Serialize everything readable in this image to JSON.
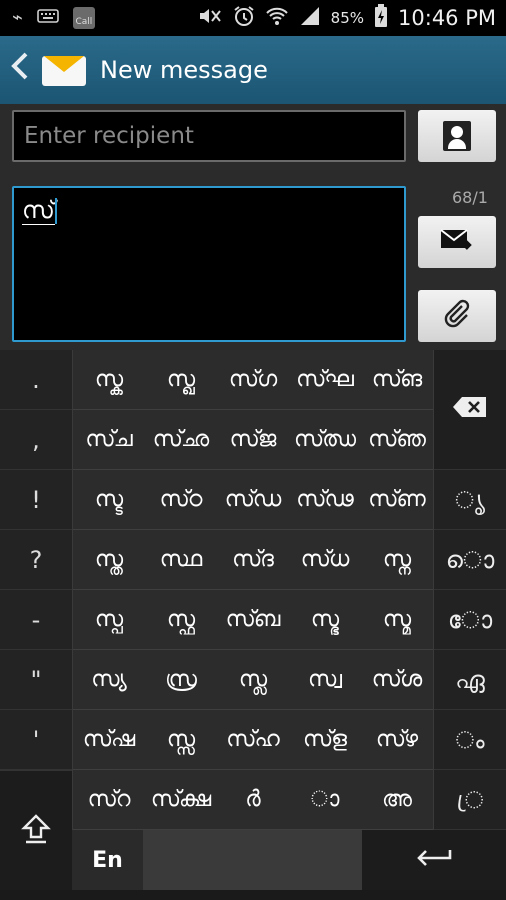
{
  "status_bar": {
    "battery_percent": "85%",
    "time": "10:46 PM",
    "call_label": "Call",
    "icons": [
      "usb-icon",
      "keyboard-icon",
      "call-icon",
      "mute-icon",
      "alarm-icon",
      "wifi-icon",
      "signal-icon",
      "battery-icon"
    ]
  },
  "app_bar": {
    "title": "New message"
  },
  "compose": {
    "recipient_placeholder": "Enter recipient",
    "message_text": "സ്",
    "char_counter": "68/1"
  },
  "keyboard": {
    "punctuation": [
      ".",
      ",",
      "!",
      "?",
      "-",
      "\"",
      "'"
    ],
    "grid": [
      [
        "സ്ക",
        "സ്ഖ",
        "സ്ഗ",
        "സ്ഘ",
        "സ്ങ"
      ],
      [
        "സ്ച",
        "സ്ഛ",
        "സ്ജ",
        "സ്ഝ",
        "സ്ഞ"
      ],
      [
        "സ്ട",
        "സ്ഠ",
        "സ്ഡ",
        "സ്ഢ",
        "സ്ണ"
      ],
      [
        "സ്ത",
        "സ്ഥ",
        "സ്ദ",
        "സ്ധ",
        "സ്ന"
      ],
      [
        "സ്പ",
        "സ്ഫ",
        "സ്ബ",
        "സ്ഭ",
        "സ്മ"
      ],
      [
        "സ്യ",
        "സ്ര",
        "സ്ല",
        "സ്വ",
        "സ്ശ"
      ],
      [
        "സ്ഷ",
        "സ്സ",
        "സ്ഹ",
        "സ്ള",
        "സ്ഴ"
      ],
      [
        "സ്റ",
        "സ്ക്ഷ",
        "ർ",
        "ാ",
        "അ"
      ]
    ],
    "right_keys": [
      "ൃ",
      "ൊ",
      "ോ",
      "ഏ",
      "ം",
      "്ര"
    ],
    "lang_label": "En"
  }
}
